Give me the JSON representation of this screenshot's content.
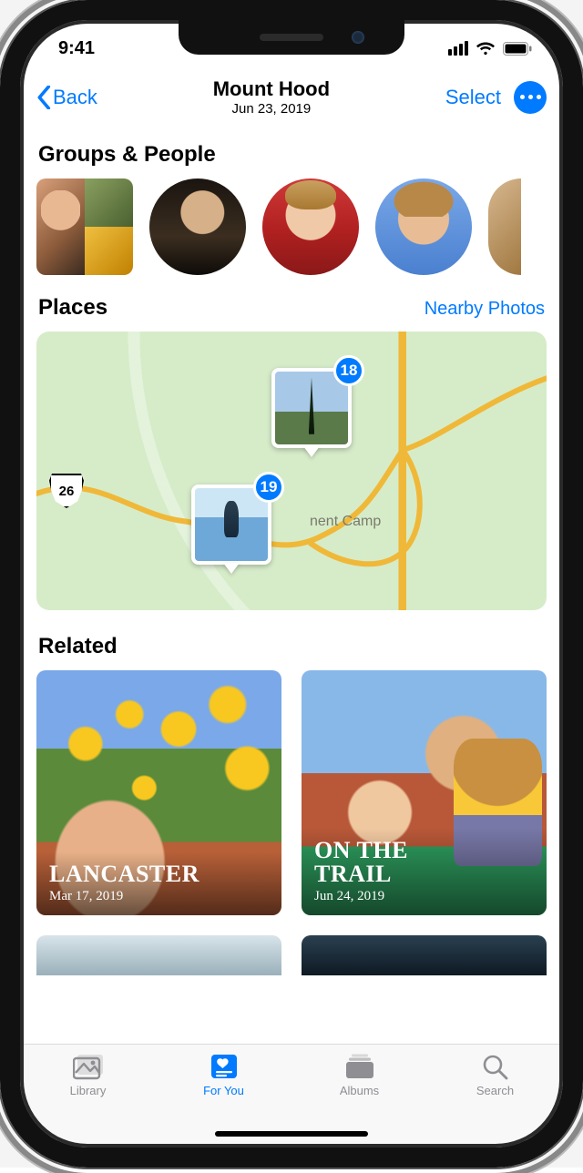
{
  "status": {
    "time": "9:41"
  },
  "nav": {
    "back_label": "Back",
    "title": "Mount Hood",
    "subtitle": "Jun 23, 2019",
    "select_label": "Select"
  },
  "sections": {
    "groups_people": {
      "title": "Groups & People"
    },
    "places": {
      "title": "Places",
      "nearby_link": "Nearby Photos",
      "highway_shield": "26",
      "map_label": "nent Camp",
      "pins": [
        {
          "count": "18"
        },
        {
          "count": "19"
        }
      ]
    },
    "related": {
      "title": "Related",
      "cards": [
        {
          "title": "LANCASTER",
          "date": "Mar 17, 2019"
        },
        {
          "title": "ON THE\nTRAIL",
          "date": "Jun 24, 2019"
        }
      ]
    }
  },
  "tabs": {
    "library": "Library",
    "for_you": "For You",
    "albums": "Albums",
    "search": "Search"
  }
}
